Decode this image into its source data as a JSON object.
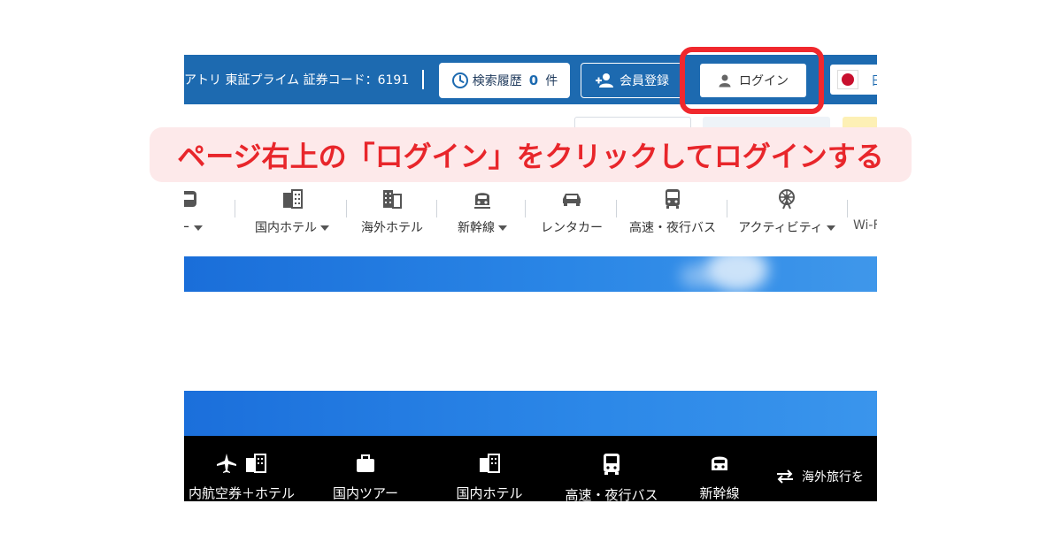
{
  "topbar": {
    "company": "アトリ 東証プライム 証券コード：6191",
    "history_label": "検索履歴",
    "history_count": "0",
    "history_unit": "件",
    "register_label": "会員登録",
    "login_label": "ログイン",
    "lang_text": "日"
  },
  "categories": [
    {
      "label": "アー",
      "icon": "train-icon",
      "caret": true
    },
    {
      "label": "国内ホテル",
      "icon": "hotel-icon",
      "caret": true
    },
    {
      "label": "海外ホテル",
      "icon": "building-icon",
      "caret": false
    },
    {
      "label": "新幹線",
      "icon": "shinkansen-icon",
      "caret": true
    },
    {
      "label": "レンタカー",
      "icon": "car-icon",
      "caret": false
    },
    {
      "label": "高速・夜行バス",
      "icon": "bus-icon",
      "caret": false
    },
    {
      "label": "アクティビティ",
      "icon": "ferris-wheel-icon",
      "caret": true
    },
    {
      "label": "Wi-F",
      "icon": "wifi-icon",
      "caret": false
    }
  ],
  "bottom_nav": [
    {
      "label": "内航空券＋ホテル",
      "icon": "plane-hotel-icon"
    },
    {
      "label": "国内ツアー",
      "icon": "suitcase-icon"
    },
    {
      "label": "国内ホテル",
      "icon": "hotel-icon"
    },
    {
      "label": "高速・夜行バス",
      "icon": "bus-icon"
    },
    {
      "label": "新幹線",
      "icon": "shinkansen-icon"
    }
  ],
  "overseas_label": "海外旅行を",
  "annotation": {
    "text": "ページ右上の「ログイン」をクリックしてログインする",
    "color": "#f0282d",
    "background": "#fde9ea"
  },
  "colors": {
    "topbar": "#1d6ab0",
    "accent_red": "#f0282d",
    "sky": "#2a86e6"
  }
}
